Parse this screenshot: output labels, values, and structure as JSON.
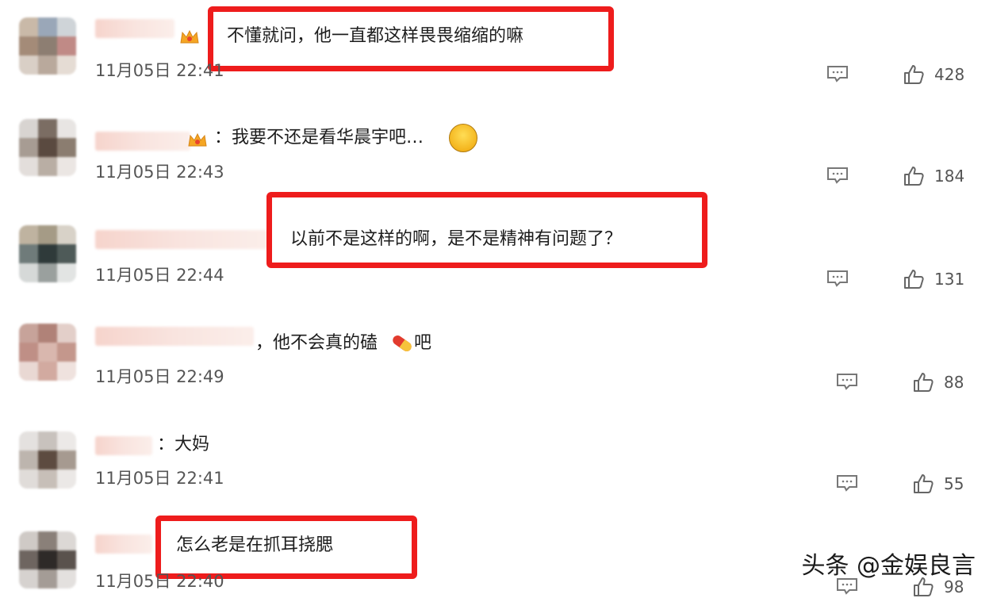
{
  "comments": [
    {
      "text": "不懂就问，他一直都这样畏畏缩缩的嘛",
      "time": "11月05日 22:41",
      "likes": "428"
    },
    {
      "text": "：我要不还是看华晨宇吧…",
      "time": "11月05日 22:43",
      "likes": "184"
    },
    {
      "text": "以前不是这样的啊，是不是精神有问题了？",
      "time": "11月05日 22:44",
      "likes": "131"
    },
    {
      "text": "，他不会真的磕",
      "text2": "吧",
      "time": "11月05日 22:49",
      "likes": "88"
    },
    {
      "text": "：大妈",
      "time": "11月05日 22:41",
      "likes": "55"
    },
    {
      "text": "怎么老是在抓耳挠腮",
      "time": "11月05日 22:40",
      "likes": "98"
    }
  ],
  "watermark": "头条 @金娱良言",
  "colors": {
    "highlight": "#ee1c1c",
    "meta_text": "#555555"
  },
  "icons": {
    "reply": "comment-bubble-icon",
    "like": "thumbs-up-icon"
  }
}
